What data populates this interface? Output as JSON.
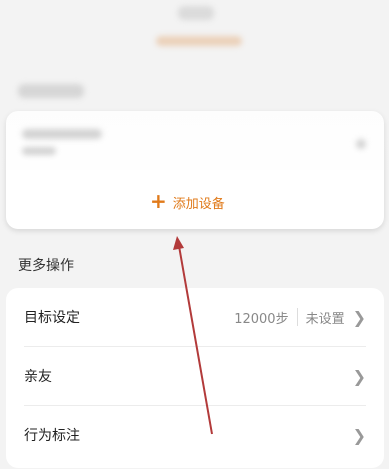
{
  "add_device": {
    "label": "添加设备"
  },
  "more_actions": {
    "title": "更多操作"
  },
  "rows": [
    {
      "label": "目标设定",
      "value": "12000步",
      "status": "未设置"
    },
    {
      "label": "亲友"
    },
    {
      "label": "行为标注"
    }
  ],
  "icons": {
    "plus": "plus-icon",
    "chevron": "chevron-right-icon"
  },
  "colors": {
    "accent": "#e07a1a",
    "annotation_arrow": "#b23a3a"
  }
}
